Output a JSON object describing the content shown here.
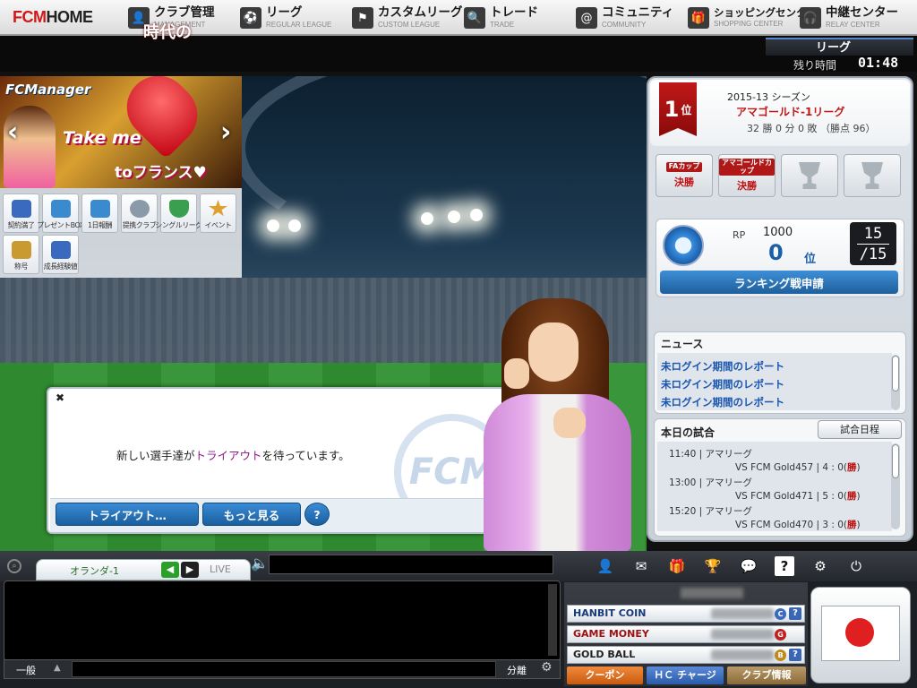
{
  "topnav": {
    "logo_fcm": "FCM",
    "logo_home": "HOME",
    "items": [
      {
        "jp": "クラブ管理",
        "en": "MANAGEMENT"
      },
      {
        "jp": "リーグ",
        "en": "REGULAR LEAGUE"
      },
      {
        "jp": "カスタムリーグ",
        "en": "CUSTOM LEAGUE"
      },
      {
        "jp": "トレード",
        "en": "TRADE"
      },
      {
        "jp": "コミュニティ",
        "en": "COMMUNITY"
      },
      {
        "jp": "ショッピングセンター",
        "en": "SHOPPING CENTER"
      },
      {
        "jp": "中継センター",
        "en": "RELAY CENTER"
      }
    ]
  },
  "league_strip": {
    "tab_label": "リーグ",
    "remaining_label": "残り時間",
    "remaining_time": "01:48"
  },
  "banner": {
    "logo": "FCManager",
    "heart_text": "時代の",
    "line1": "Take me",
    "line2": "toフランス♥"
  },
  "menu_icons": [
    {
      "label": "契約満了",
      "color": "#3a6ac0"
    },
    {
      "label": "プレゼントBOX",
      "color": "#3a8ad0"
    },
    {
      "label": "1日報酬",
      "color": "#3a8ad0"
    },
    {
      "label": "提携クラブ",
      "color": "#8a9aa8"
    },
    {
      "label": "シングルリーグ",
      "color": "#3aa050"
    },
    {
      "label": "イベント",
      "color": "#e0a030"
    },
    {
      "label": "称号",
      "color": "#c89a30"
    },
    {
      "label": "成長経験値",
      "color": "#3a6ac0"
    }
  ],
  "dialog": {
    "close": "✖",
    "msg_before": "新しい選手達が",
    "msg_highlight": "トライアウト",
    "msg_after": "を待っています。",
    "btn_tryout": "トライアウト…",
    "btn_more": "もっと見る",
    "btn_help": "?",
    "watermark": "FCM"
  },
  "ranking": {
    "rank": "1",
    "rank_unit": "位",
    "season": "2015-13 シーズン",
    "league": "アマゴールド-1リーグ",
    "record": "32 勝 0 分 0 敗 （勝点 96）",
    "cups": [
      {
        "tag": "FAカップ",
        "result": "決勝"
      },
      {
        "tag": "アマゴールドカップ",
        "result": "決勝"
      }
    ],
    "rp_label": "RP",
    "rp_value": "1000",
    "rp_place": "0",
    "rp_place_unit": "位",
    "fraction_top": "15",
    "fraction_bottom": "/15",
    "ranking_button": "ランキング戦申請"
  },
  "news": {
    "header": "ニュース",
    "items": [
      "未ログイン期間のレポート",
      "未ログイン期間のレポート",
      "未ログイン期間のレポート"
    ]
  },
  "matches": {
    "header": "本日の試合",
    "schedule_button": "試合日程",
    "rows": [
      {
        "line1": "11:40 | アマリーグ",
        "line2": "VS FCM Gold457 | 4 : 0(",
        "result": "勝",
        "close": ")"
      },
      {
        "line1": "13:00 | アマリーグ",
        "line2": "VS FCM Gold471 | 5 : 0(",
        "result": "勝",
        "close": ")"
      },
      {
        "line1": "15:20 | アマリーグ",
        "line2": "VS FCM Gold470 | 3 : 0(",
        "result": "勝",
        "close": ")"
      }
    ]
  },
  "chat": {
    "tab_label": "オランダ-1",
    "live_label": "LIVE",
    "channel": "一般",
    "split": "分離"
  },
  "toolbar_icons": [
    "profile-icon",
    "mail-icon",
    "gift-icon",
    "trophy-icon",
    "chat-icon",
    "help-icon",
    "gear-icon",
    "power-icon"
  ],
  "currencies": [
    {
      "name": "HANBIT COIN",
      "coin": "C",
      "coin_color": "#3a6ac0",
      "name_color": "#1a3a7a",
      "help": "?"
    },
    {
      "name": "GAME MONEY",
      "coin": "G",
      "coin_color": "#c02020",
      "name_color": "#a01010",
      "help": ""
    },
    {
      "name": "GOLD BALL",
      "coin": "B",
      "coin_color": "#c08a20",
      "name_color": "#222222",
      "help": "?"
    }
  ],
  "bottom_buttons": {
    "coupon": "クーポン",
    "charge": "ＨＣ チャージ",
    "club_info": "クラブ情報"
  },
  "colors": {
    "accent_blue": "#1d5f9c",
    "win_red": "#c01010",
    "brand_red": "#d01818"
  }
}
